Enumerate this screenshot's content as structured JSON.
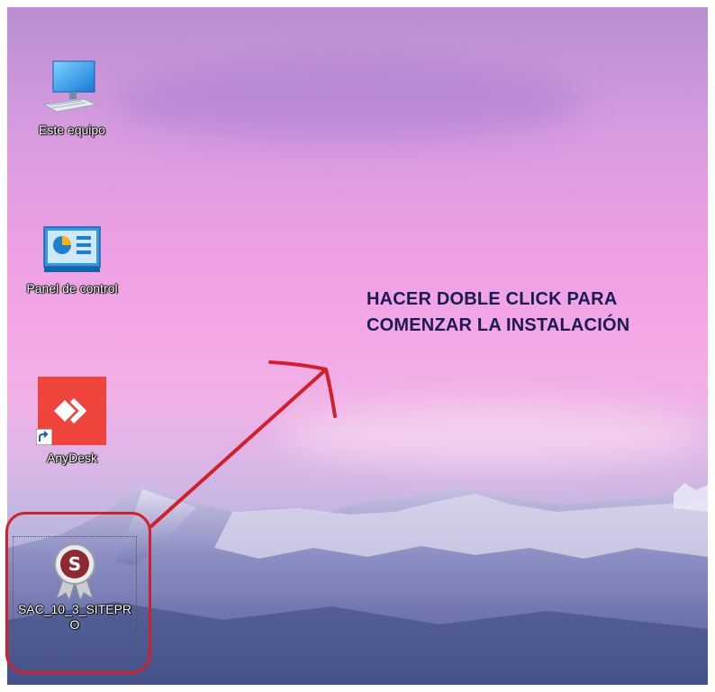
{
  "desktop": {
    "icons": [
      {
        "label": "Este equipo",
        "icon": "computer-icon"
      },
      {
        "label": "Panel de control",
        "icon": "control-panel-icon"
      },
      {
        "label": "AnyDesk",
        "icon": "anydesk-icon",
        "shortcut": true
      },
      {
        "label_line1": "SAC_10_3_SITEPR",
        "label_line2": "O",
        "icon": "sac-installer-icon",
        "selected": true
      }
    ]
  },
  "annotation": {
    "line1": "HACER DOBLE CLICK PARA",
    "line2": "COMENZAR LA INSTALACIÓN",
    "color": "#1a1a55",
    "highlight_color": "#d11f2b"
  }
}
